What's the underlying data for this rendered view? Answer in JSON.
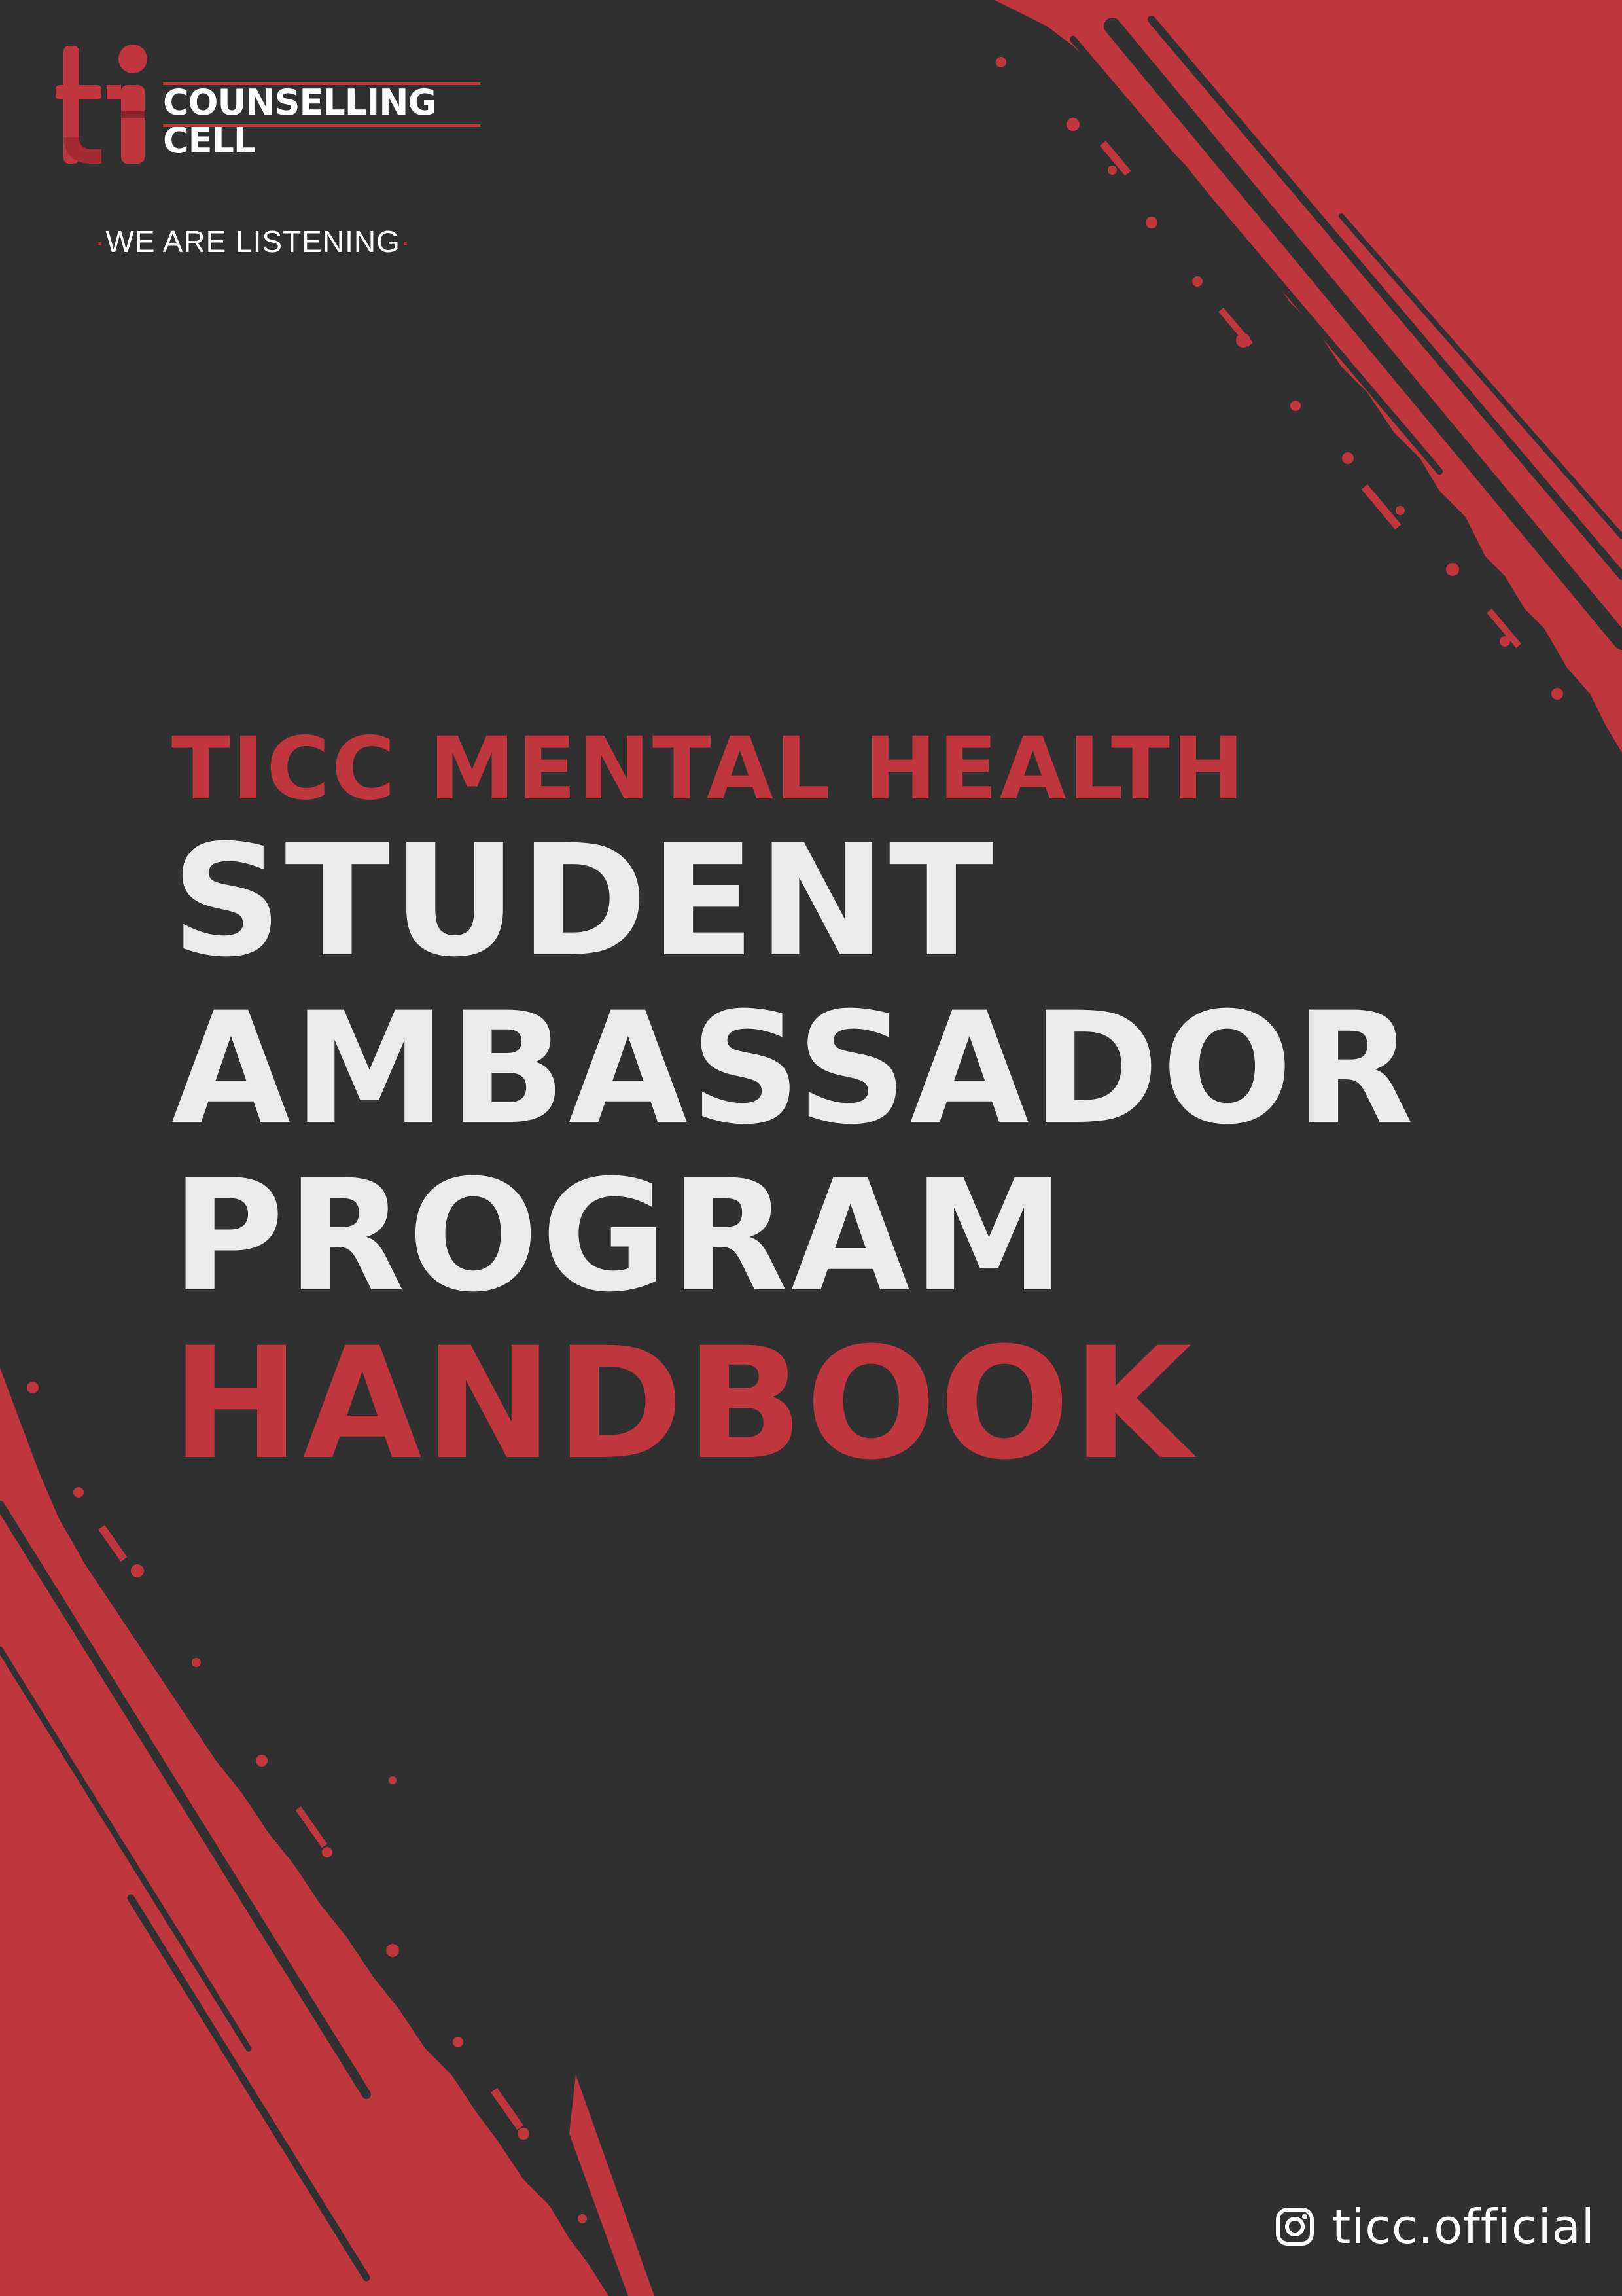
{
  "colors": {
    "background": "#303030",
    "accent": "#c0363e",
    "title_text": "#ebebeb",
    "white": "#ffffff"
  },
  "logo": {
    "mark_letters": "ti",
    "line1": "COUNSELLING",
    "line2": "CELL",
    "tagline": "WE ARE LISTENING"
  },
  "title": {
    "kicker": "TICC MENTAL HEALTH",
    "line1": "STUDENT",
    "line2": "AMBASSADOR",
    "line3": "PROGRAM",
    "line4": "HANDBOOK"
  },
  "footer": {
    "icon": "instagram-icon",
    "handle": "ticc.official"
  }
}
